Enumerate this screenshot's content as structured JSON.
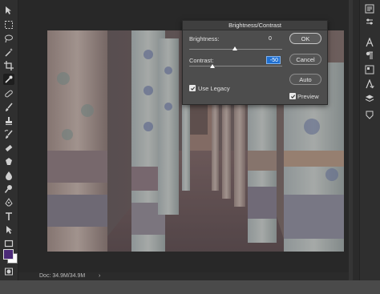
{
  "dialog": {
    "title": "Brightness/Contrast",
    "brightness_label": "Brightness:",
    "brightness_value": "0",
    "contrast_label": "Contrast:",
    "contrast_value": "-50",
    "use_legacy_label": "Use Legacy",
    "use_legacy_checked": true,
    "preview_label": "Preview",
    "preview_checked": true,
    "ok_label": "OK",
    "cancel_label": "Cancel",
    "auto_label": "Auto"
  },
  "status": {
    "doc_info": "Doc: 34.9M/34.9M",
    "arrow": "›"
  },
  "tools": [
    "move-tool-icon",
    "marquee-tool-icon",
    "lasso-tool-icon",
    "magic-wand-tool-icon",
    "crop-tool-icon",
    "eyedropper-tool-icon",
    "healing-brush-tool-icon",
    "brush-tool-icon",
    "clone-stamp-tool-icon",
    "history-brush-tool-icon",
    "eraser-tool-icon",
    "gradient-tool-icon",
    "blur-tool-icon",
    "dodge-tool-icon",
    "pen-tool-icon",
    "type-tool-icon",
    "path-selection-tool-icon",
    "rectangle-tool-icon",
    "hand-tool-icon",
    "zoom-tool-icon"
  ],
  "colors": {
    "foreground": "#4b2a78",
    "background": "#ffffff"
  }
}
